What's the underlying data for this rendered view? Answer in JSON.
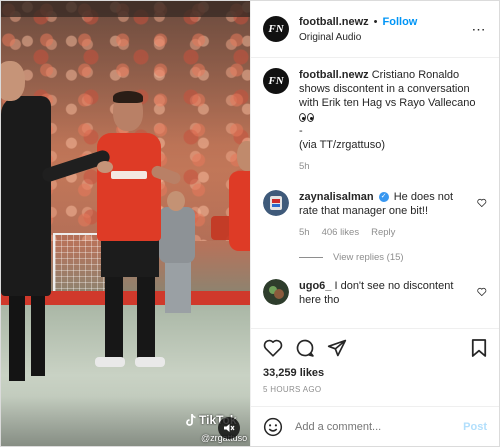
{
  "media": {
    "watermark": "TikTok",
    "watermark_handle": "@zrgattuso"
  },
  "header": {
    "avatar_text": "FN",
    "username": "football.newz",
    "separator": "•",
    "follow_label": "Follow",
    "subtitle": "Original Audio"
  },
  "caption": {
    "avatar_text": "FN",
    "username": "football.newz",
    "text": "Cristiano Ronaldo shows discontent in a conversation with Erik ten Hag vs Rayo Vallecano",
    "line_dash": "-",
    "via": "(via TT/zrgattuso)",
    "time": "5h"
  },
  "comments": [
    {
      "username": "zaynalisalman",
      "verified": true,
      "text": "He does not rate that manager one bit!!",
      "time": "5h",
      "likes": "406 likes",
      "reply_label": "Reply",
      "view_replies": "View replies (15)"
    },
    {
      "username": "ugo6_",
      "text": "I don't see no discontent here tho"
    }
  ],
  "actions": {
    "likes": "33,259 likes",
    "time": "5 HOURS AGO"
  },
  "comment_box": {
    "placeholder": "Add a comment...",
    "post_label": "Post"
  },
  "colors": {
    "accent": "#0095f6",
    "post_disabled": "#b2dffc",
    "jersey": "#de3b26"
  }
}
